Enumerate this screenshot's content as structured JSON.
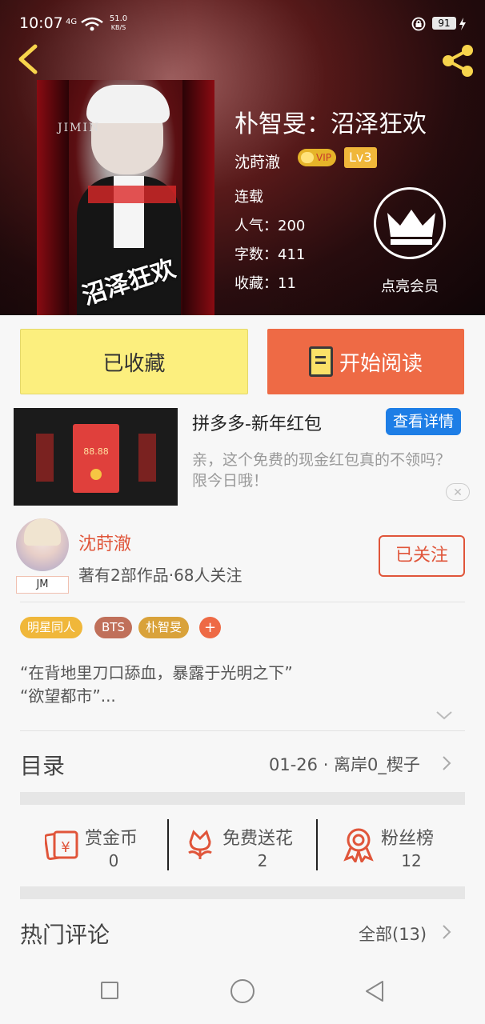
{
  "status": {
    "time": "10:07",
    "network": "4G",
    "speed_value": "51.0",
    "speed_unit": "KB/S",
    "battery": "91"
  },
  "book": {
    "title": "朴智旻：沼泽狂欢",
    "author": "沈莳澈",
    "vip_label": "VIP",
    "level": "Lv3",
    "status": "连载",
    "popularity": "人气：200",
    "word_count": "字数：411",
    "favorites": "收藏：11",
    "cover_name": "JIMIN",
    "cover_title": "沼泽狂欢"
  },
  "vip": {
    "label": "点亮会员"
  },
  "actions": {
    "collected_label": "已收藏",
    "read_label": "开始阅读"
  },
  "ad": {
    "title": "拼多多-新年红包",
    "button": "查看详情",
    "description": "亲，这个免费的现金红包真的不领吗？限今日哦！",
    "amount": "88.88",
    "close": "✕"
  },
  "author_card": {
    "name": "沈莳澈",
    "stats": "著有2部作品·68人关注",
    "tag": "JM",
    "follow_label": "已关注"
  },
  "tags": [
    {
      "label": "明星同人",
      "color": "#f0b73a"
    },
    {
      "label": "BTS",
      "color": "#c0705a"
    },
    {
      "label": "朴智旻",
      "color": "#d9a23a"
    }
  ],
  "tag_add": "+",
  "synopsis": {
    "line1": "“在背地里刀口舔血，暴露于光明之下”",
    "line2": "“欲望都市”..."
  },
  "toc": {
    "label": "目录",
    "latest": "01-26 · 离岸0_楔子"
  },
  "stats": {
    "reward_label": "赏金币",
    "reward_value": "0",
    "flower_label": "免费送花",
    "flower_value": "2",
    "fans_label": "粉丝榜",
    "fans_value": "12"
  },
  "comments": {
    "label": "热门评论",
    "all": "全部(13)"
  },
  "colors": {
    "accent": "#ee6a45",
    "collected": "#fcef7e",
    "author_red": "#e0553a",
    "ad_blue": "#1e7ee6",
    "gold": "#f0b73a"
  },
  "icons": {
    "back": "back-arrow-icon",
    "share": "share-icon",
    "crown": "crown-icon",
    "book": "book-icon",
    "reward": "coin-icon",
    "flower": "flower-icon",
    "fans": "medal-icon"
  }
}
